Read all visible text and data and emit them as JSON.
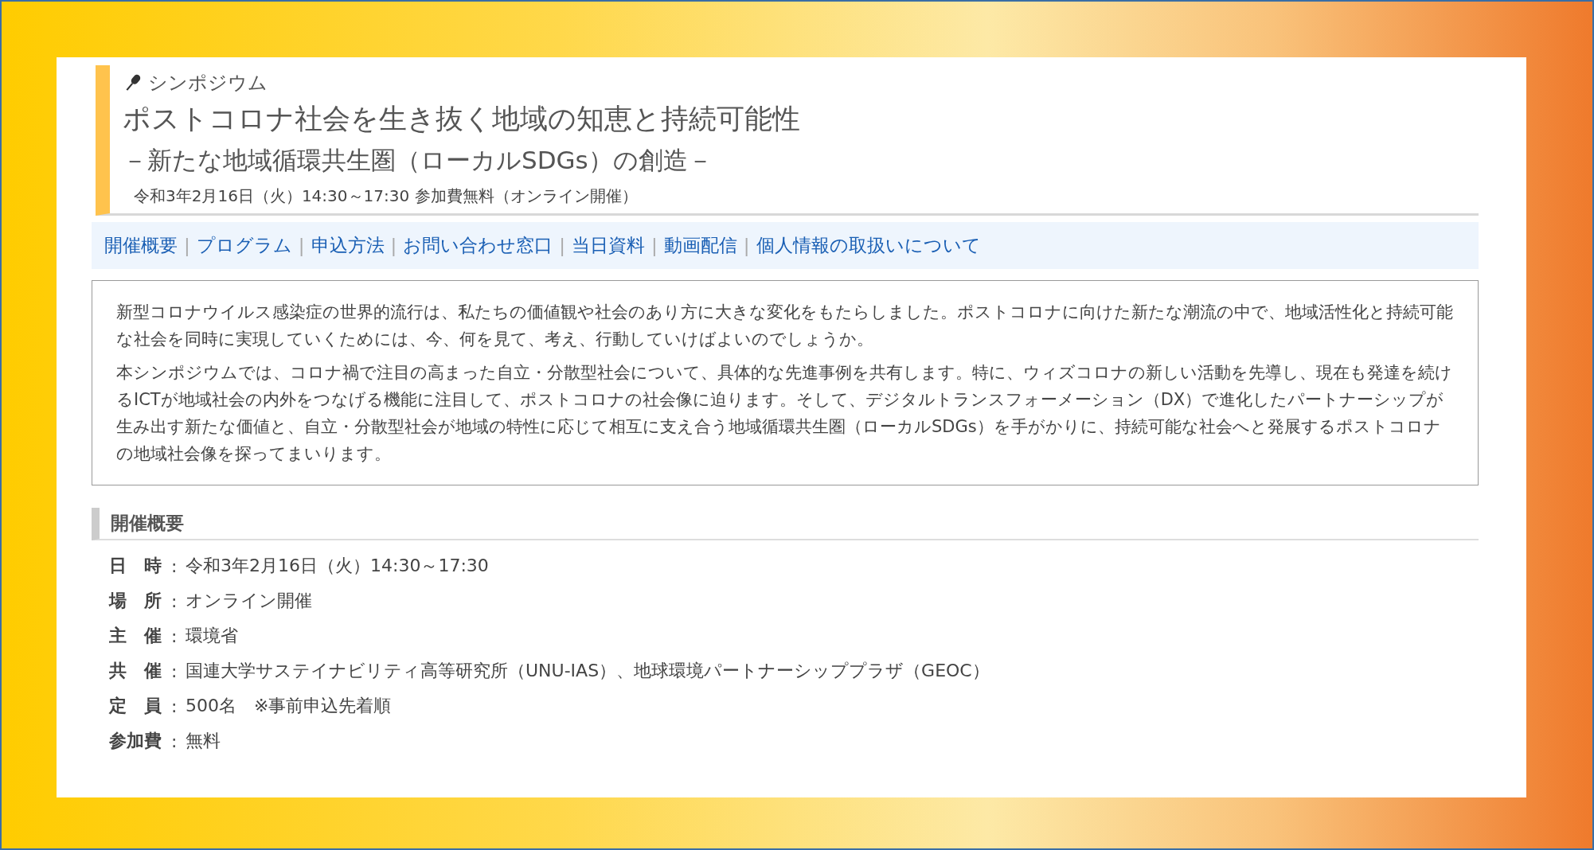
{
  "header": {
    "category": "シンポジウム",
    "title": "ポストコロナ社会を生き抜く地域の知恵と持続可能性",
    "subtitle": "－新たな地域循環共生圏（ローカルSDGs）の創造－",
    "date_line": "令和3年2月16日（火）14:30～17:30 参加費無料（オンライン開催）"
  },
  "nav": {
    "separator": "|",
    "links": [
      {
        "label": "開催概要"
      },
      {
        "label": "プログラム"
      },
      {
        "label": "申込方法"
      },
      {
        "label": "お問い合わせ窓口"
      },
      {
        "label": "当日資料"
      },
      {
        "label": "動画配信"
      },
      {
        "label": "個人情報の取扱いについて"
      }
    ]
  },
  "intro": [
    "新型コロナウイルス感染症の世界的流行は、私たちの価値観や社会のあり方に大きな変化をもたらしました。ポストコロナに向けた新たな潮流の中で、地域活性化と持続可能な社会を同時に実現していくためには、今、何を見て、考え、行動していけばよいのでしょうか。",
    "本シンポジウムでは、コロナ禍で注目の高まった自立・分散型社会について、具体的な先進事例を共有します。特に、ウィズコロナの新しい活動を先導し、現在も発達を続けるICTが地域社会の内外をつなげる機能に注目して、ポストコロナの社会像に迫ります。そして、デジタルトランスフォーメーション（DX）で進化したパートナーシップが生み出す新たな価値と、自立・分散型社会が地域の特性に応じて相互に支え合う地域循環共生圏（ローカルSDGs）を手がかりに、持続可能な社会へと発展するポストコロナの地域社会像を探ってまいります。"
  ],
  "overview": {
    "heading": "開催概要",
    "rows": [
      {
        "label": "日　時",
        "colon": ":",
        "value": "令和3年2月16日（火）14:30～17:30"
      },
      {
        "label": "場　所",
        "colon": ":",
        "value": "オンライン開催"
      },
      {
        "label": "主　催",
        "colon": ":",
        "value": "環境省"
      },
      {
        "label": "共　催",
        "colon": ":",
        "value": "国連大学サステイナビリティ高等研究所（UNU-IAS）、地球環境パートナーシッププラザ（GEOC）"
      },
      {
        "label": "定　員",
        "colon": ":",
        "value": "500名　※事前申込先着順"
      },
      {
        "label": "参加費",
        "colon": ":",
        "value": "無料"
      }
    ]
  }
}
